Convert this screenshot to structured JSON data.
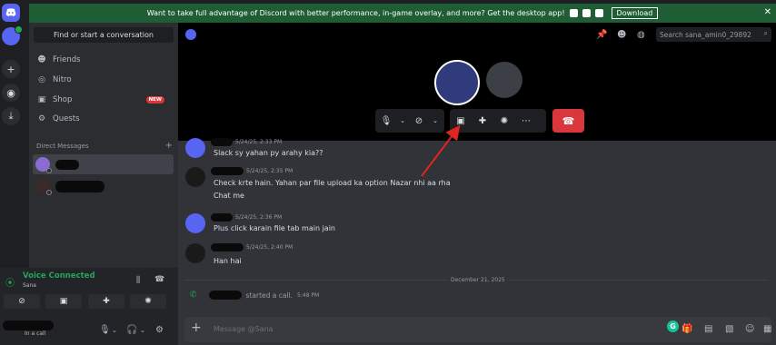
{
  "banner": {
    "text": "Want to take full advantage of Discord with better performance, in-game overlay, and more? Get the desktop app!",
    "download_label": "Download",
    "close_icon": "✕"
  },
  "sidebar": {
    "search_label": "Find or start a conversation",
    "nav": [
      {
        "label": "Friends",
        "icon": "friends-icon"
      },
      {
        "label": "Nitro",
        "icon": "nitro-icon"
      },
      {
        "label": "Shop",
        "icon": "shop-icon",
        "badge": "NEW"
      },
      {
        "label": "Quests",
        "icon": "quests-icon"
      }
    ],
    "dm_header": "Direct Messages"
  },
  "voice": {
    "status": "Voice Connected",
    "channel": "Sana"
  },
  "user": {
    "status": "In a call"
  },
  "header": {
    "search_placeholder": "Search sana_amin0_29892"
  },
  "messages": [
    {
      "time": "5/24/25, 2:33 PM",
      "lines": [
        "Slack sy yahan py arahy kia??"
      ]
    },
    {
      "time": "5/24/25, 2:35 PM",
      "lines": [
        "Check krte hain. Yahan par file upload ka option Nazar nhi aa rha",
        "Chat me"
      ]
    },
    {
      "time": "5/24/25, 2:36 PM",
      "lines": [
        "Plus click karain file tab main jain"
      ]
    },
    {
      "time": "5/24/25, 2:40 PM",
      "lines": [
        "Han hai"
      ]
    }
  ],
  "divider_date": "December 21, 2025",
  "system": {
    "text": "started a call.",
    "time": "5:48 PM"
  },
  "composer": {
    "placeholder": "Message @Sana"
  },
  "colors": {
    "blurple": "#5865f2",
    "green": "#23a55a",
    "red": "#da373c",
    "banner": "#1f5e34",
    "annotation_arrow": "#e02424"
  }
}
